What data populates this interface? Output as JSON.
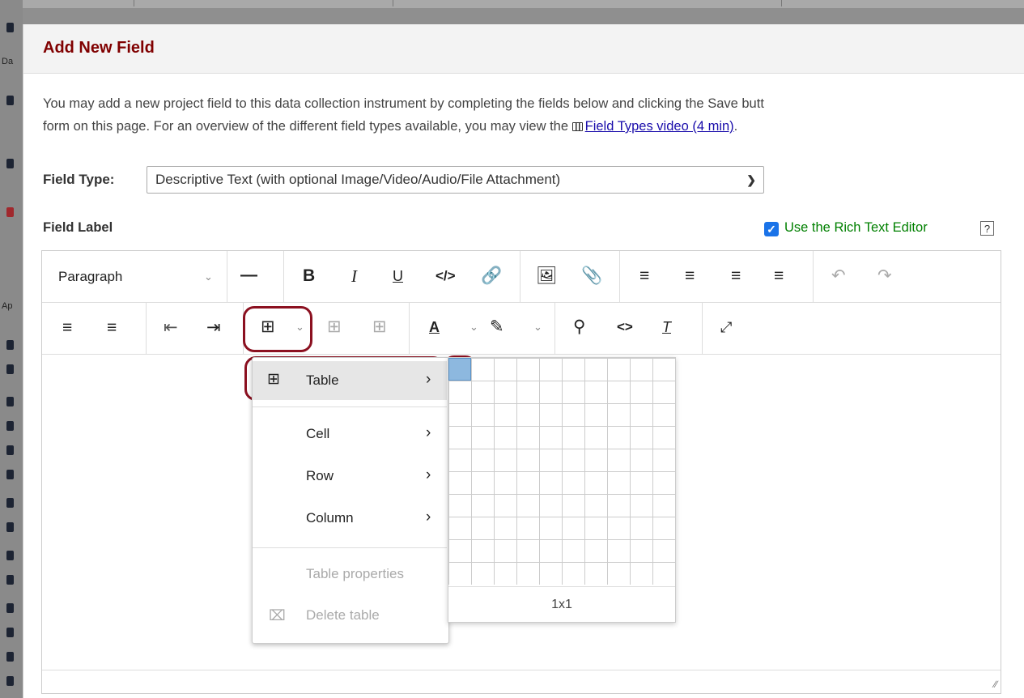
{
  "dialog": {
    "title": "Add New Field",
    "intro_line1": "You may add a new project field to this data collection instrument by completing the fields below and clicking the Save butt",
    "intro_line2_prefix": "form on this page. For an overview of the different field types available, you may view the",
    "video_link": "Field Types video (4 min)",
    "intro_line2_suffix": "."
  },
  "field_type": {
    "label": "Field Type:",
    "value": "Descriptive Text (with optional Image/Video/Audio/File Attachment)"
  },
  "field_label": {
    "label": "Field Label",
    "rich_text_checked": true,
    "rich_text_label": "Use the Rich Text Editor",
    "help": "?"
  },
  "toolbar": {
    "paragraph": "Paragraph",
    "row1_icons": [
      "horizontal-rule-icon",
      "bold-icon",
      "italic-icon",
      "underline-icon",
      "code-icon",
      "link-icon",
      "image-icon",
      "attachment-icon",
      "align-left-icon",
      "align-center-icon",
      "align-right-icon",
      "align-justify-icon",
      "undo-icon",
      "redo-icon"
    ],
    "row2_icons": [
      "bullet-list-icon",
      "numbered-list-icon",
      "outdent-icon",
      "indent-icon",
      "table-icon",
      "table-cell-props-icon",
      "table-props-icon",
      "text-color-icon",
      "highlight-color-icon",
      "search-icon",
      "source-code-icon",
      "clear-format-icon",
      "fullscreen-icon"
    ]
  },
  "table_menu": {
    "items": [
      {
        "label": "Table",
        "submenu": true,
        "active": true
      },
      {
        "label": "Cell",
        "submenu": true
      },
      {
        "label": "Row",
        "submenu": true
      },
      {
        "label": "Column",
        "submenu": true
      },
      {
        "label": "Table properties",
        "disabled": true
      },
      {
        "label": "Delete table",
        "disabled": true
      }
    ]
  },
  "table_grid": {
    "size_label": "1x1",
    "rows": 10,
    "cols": 10
  },
  "colors": {
    "title": "#800000",
    "highlight": "#8b1020",
    "checkbox": "#1a73e8",
    "rte_label": "#008000"
  }
}
